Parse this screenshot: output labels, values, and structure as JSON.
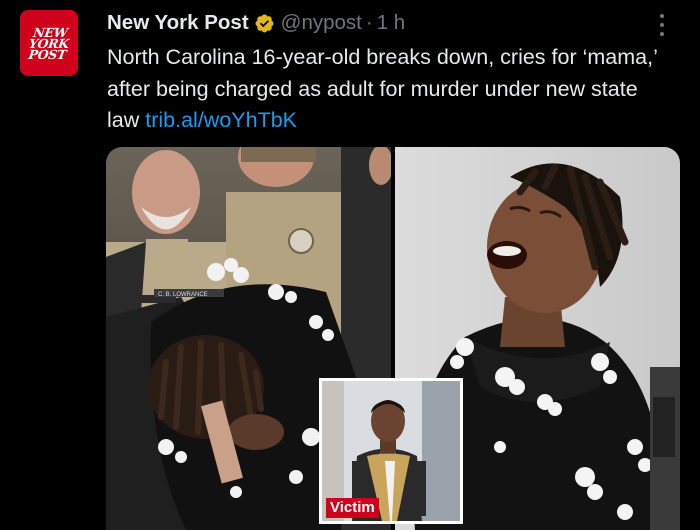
{
  "tweet": {
    "avatar_text": [
      "NEW",
      "YORK",
      "POST"
    ],
    "display_name": "New York Post",
    "handle": "@nypost",
    "separator": "·",
    "time": "1 h",
    "text_plain": "North Carolina 16-year-old breaks down, cries for ‘mama,’ after being charged as adult for murder under new state law",
    "link_text": "trib.al/woYhTbK"
  },
  "media": {
    "inset_label": "Victim",
    "badge_text": "C. B. LOWRANCE"
  },
  "colors": {
    "background": "#000000",
    "text": "#e7e9ea",
    "secondary": "#71767b",
    "link": "#1d9bf0",
    "brand_red": "#d0021b",
    "verified_gold": "#e2b719"
  }
}
